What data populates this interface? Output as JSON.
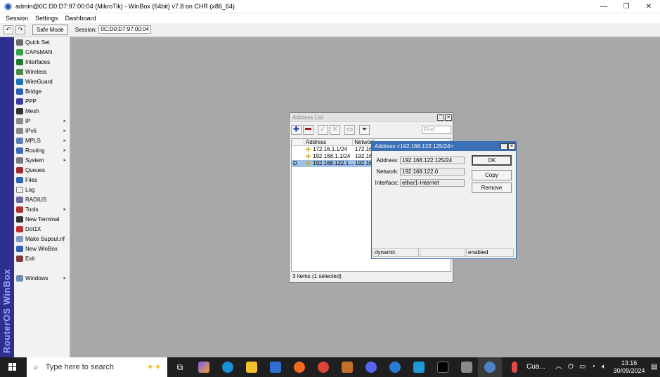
{
  "window": {
    "title": "admin@0C:D0:D7:97:00:04 (MikroTik) - WinBox (64bit) v7.8 on CHR (x86_64)",
    "minimize": "—",
    "maximize": "❐",
    "close": "✕"
  },
  "menu": [
    "Session",
    "Settings",
    "Dashboard"
  ],
  "toolbar": {
    "undo": "↶",
    "redo": "↷",
    "safe_mode": "Safe Mode",
    "session_label": "Session:",
    "session_value": "0C:D0:D7:97:00:04"
  },
  "brand": "RouterOS WinBox",
  "sidebar": {
    "items": [
      {
        "label": "Quick Set",
        "icon": "quick-set-icon",
        "color": "#6b6b6b",
        "sub": false
      },
      {
        "label": "CAPsMAN",
        "icon": "capsman-icon",
        "color": "#3aa04a",
        "sub": false
      },
      {
        "label": "Interfaces",
        "icon": "interfaces-icon",
        "color": "#1e7a2a",
        "sub": false
      },
      {
        "label": "Wireless",
        "icon": "wireless-icon",
        "color": "#4a8a4a",
        "sub": false
      },
      {
        "label": "WireGuard",
        "icon": "wireguard-icon",
        "color": "#1e6fbd",
        "sub": false
      },
      {
        "label": "Bridge",
        "icon": "bridge-icon",
        "color": "#2f5fb3",
        "sub": false
      },
      {
        "label": "PPP",
        "icon": "ppp-icon",
        "color": "#3a3a9a",
        "sub": false
      },
      {
        "label": "Mesh",
        "icon": "mesh-icon",
        "color": "#333333",
        "sub": false
      },
      {
        "label": "IP",
        "icon": "ip-icon",
        "color": "#8a8a8a",
        "sub": true
      },
      {
        "label": "IPv6",
        "icon": "ipv6-icon",
        "color": "#8a8a8a",
        "sub": true
      },
      {
        "label": "MPLS",
        "icon": "mpls-icon",
        "color": "#5a7fb0",
        "sub": true
      },
      {
        "label": "Routing",
        "icon": "routing-icon",
        "color": "#3c6cb6",
        "sub": true
      },
      {
        "label": "System",
        "icon": "system-icon",
        "color": "#7a7a7a",
        "sub": true
      },
      {
        "label": "Queues",
        "icon": "queues-icon",
        "color": "#a02a2a",
        "sub": false
      },
      {
        "label": "Files",
        "icon": "files-icon",
        "color": "#2f63b0",
        "sub": false
      },
      {
        "label": "Log",
        "icon": "log-icon",
        "color": "#eeeeee",
        "sub": false
      },
      {
        "label": "RADIUS",
        "icon": "radius-icon",
        "color": "#6a6a9a",
        "sub": false
      },
      {
        "label": "Tools",
        "icon": "tools-icon",
        "color": "#b03030",
        "sub": true
      },
      {
        "label": "New Terminal",
        "icon": "terminal-icon",
        "color": "#333333",
        "sub": false
      },
      {
        "label": "Dot1X",
        "icon": "dot1x-icon",
        "color": "#c03030",
        "sub": false
      },
      {
        "label": "Make Supout.rif",
        "icon": "supout-icon",
        "color": "#7a9ac0",
        "sub": false
      },
      {
        "label": "New WinBox",
        "icon": "winbox-icon",
        "color": "#2f5fb3",
        "sub": false
      },
      {
        "label": "Exit",
        "icon": "exit-icon",
        "color": "#7a3a3a",
        "sub": false
      }
    ],
    "windows": {
      "label": "Windows",
      "icon": "windows-menu-icon",
      "color": "#6a8ab0",
      "sub": true
    }
  },
  "address_list": {
    "title": "Address List",
    "find_placeholder": "Find",
    "columns": [
      "Address",
      "Network"
    ],
    "rows": [
      {
        "flag": "",
        "address": "172.16.1.1/24",
        "network": "172.16",
        "selected": false
      },
      {
        "flag": "",
        "address": "192.168.1.1/24",
        "network": "192.16",
        "selected": false
      },
      {
        "flag": "D",
        "address": "192.168.122.1...",
        "network": "192.16",
        "selected": true
      }
    ],
    "status": "3 items (1 selected)"
  },
  "address_edit": {
    "title": "Address <192.168.122.125/24>",
    "fields": [
      {
        "label": "Address:",
        "value": "192.168.122.125/24"
      },
      {
        "label": "Network:",
        "value": "192.168.122.0"
      },
      {
        "label": "Interface:",
        "value": "ether1-Internet"
      }
    ],
    "buttons": {
      "ok": "OK",
      "copy": "Copy",
      "remove": "Remove"
    },
    "status": {
      "left": "dynamic",
      "middle": "",
      "right": "enabled"
    }
  },
  "taskbar": {
    "search_placeholder": "Type here to search",
    "tray_text": "Cua...",
    "time": "13:16",
    "date": "30/09/2024"
  }
}
